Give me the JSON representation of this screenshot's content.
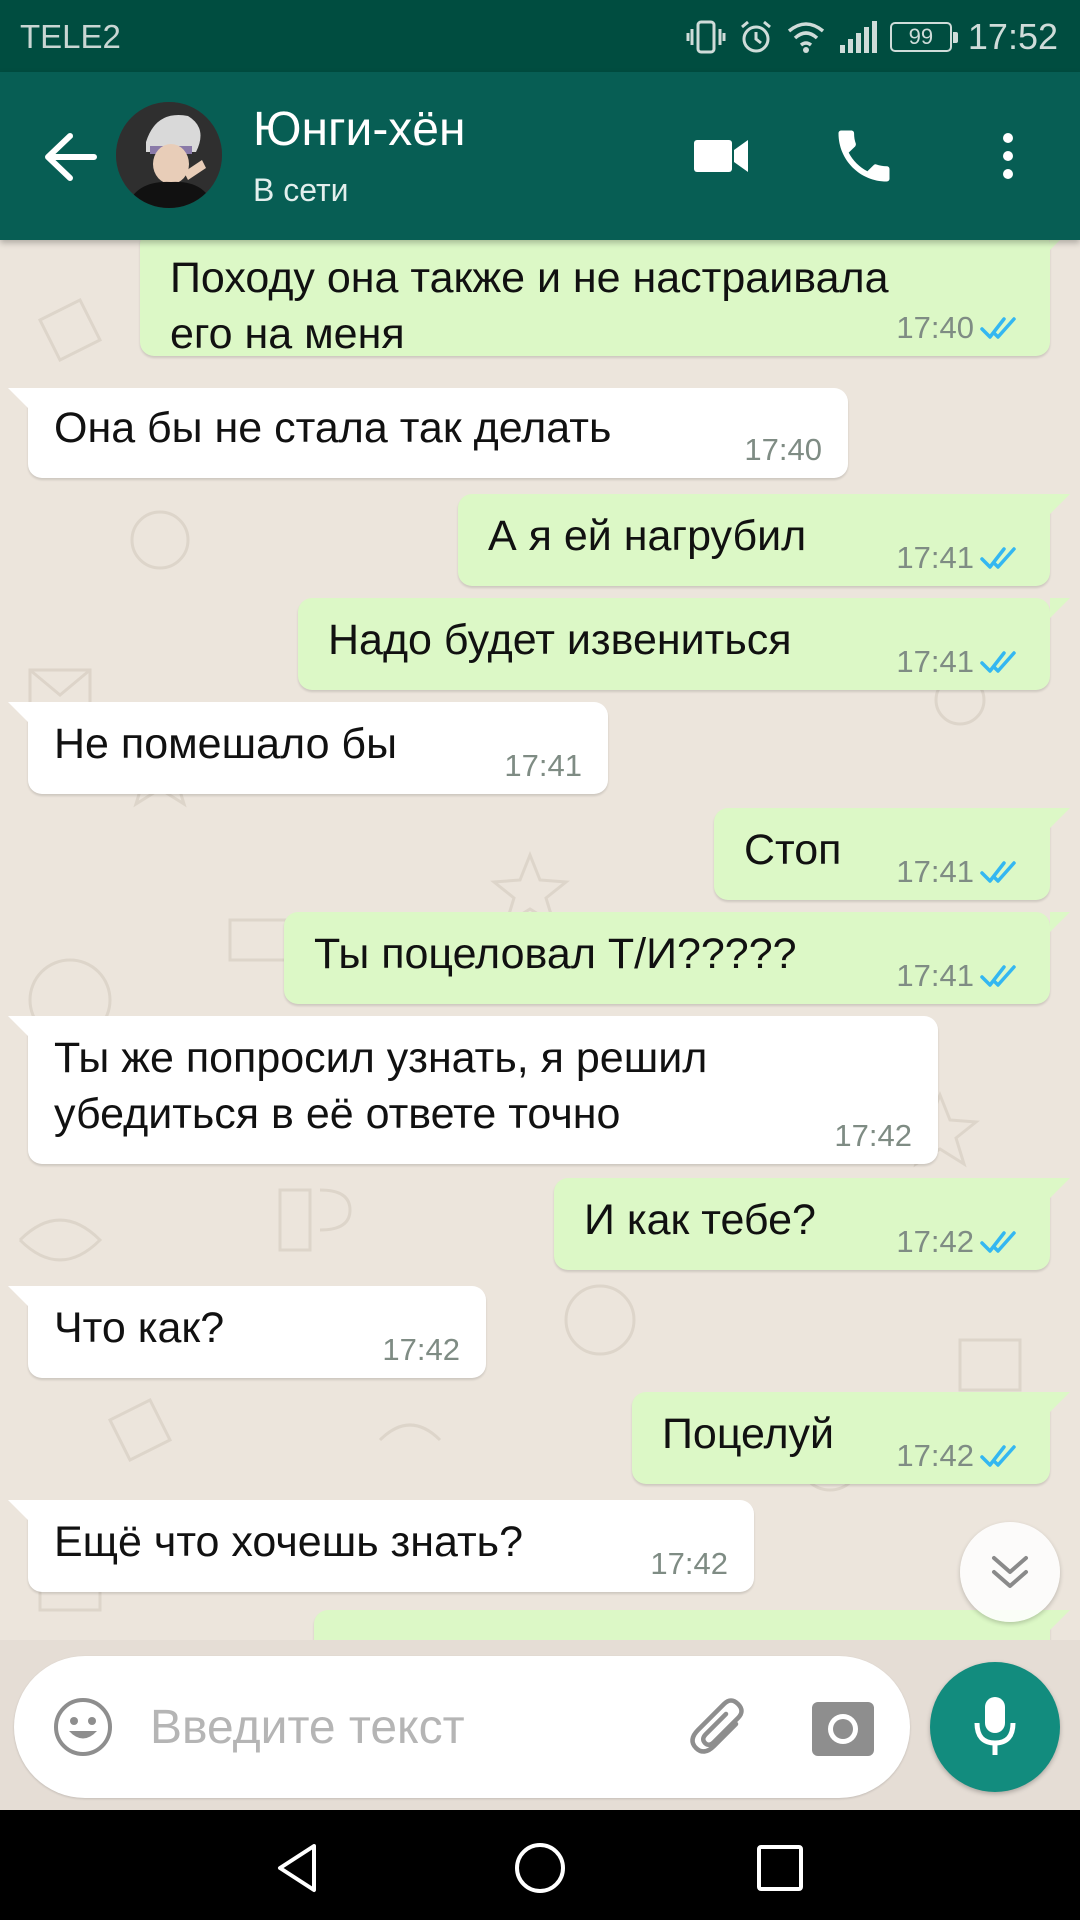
{
  "status_bar": {
    "carrier": "TELE2",
    "battery": "99",
    "time": "17:52"
  },
  "header": {
    "contact_name": "Юнги-хён",
    "contact_status": "В сети"
  },
  "messages": [
    {
      "dir": "out",
      "text": "Походу она также и не настраивала\nего на меня",
      "time": "17:40",
      "read": true
    },
    {
      "dir": "in",
      "text": "Она бы не стала так делать",
      "time": "17:40"
    },
    {
      "dir": "out",
      "text": "А я ей нагрубил",
      "time": "17:41",
      "read": true
    },
    {
      "dir": "out",
      "text": "Надо будет извениться",
      "time": "17:41",
      "read": true
    },
    {
      "dir": "in",
      "text": "Не помешало бы",
      "time": "17:41"
    },
    {
      "dir": "out",
      "text": "Стоп",
      "time": "17:41",
      "read": true
    },
    {
      "dir": "out",
      "text": "Ты поцеловал Т/И?????",
      "time": "17:41",
      "read": true
    },
    {
      "dir": "in",
      "text": "Ты же попросил узнать, я решил\nубедиться в её ответе точно",
      "time": "17:42"
    },
    {
      "dir": "out",
      "text": "И как тебе?",
      "time": "17:42",
      "read": true
    },
    {
      "dir": "in",
      "text": "Что как?",
      "time": "17:42"
    },
    {
      "dir": "out",
      "text": "Поцелуй",
      "time": "17:42",
      "read": true
    },
    {
      "dir": "in",
      "text": "Ещё что хочешь знать?",
      "time": "17:42"
    }
  ],
  "composer": {
    "placeholder": "Введите текст"
  },
  "colors": {
    "header": "#075e54",
    "status_bar": "#004d40",
    "outgoing_bubble": "#dcf8c6",
    "incoming_bubble": "#ffffff",
    "read_ticks": "#34b7f1",
    "fab": "#128c7e"
  },
  "icons": [
    "back-arrow-icon",
    "video-camera-icon",
    "phone-icon",
    "more-vert-icon",
    "double-check-icon",
    "chevron-double-down-icon",
    "emoji-icon",
    "paperclip-icon",
    "camera-icon",
    "mic-icon",
    "nav-back-icon",
    "nav-home-icon",
    "nav-recents-icon"
  ]
}
